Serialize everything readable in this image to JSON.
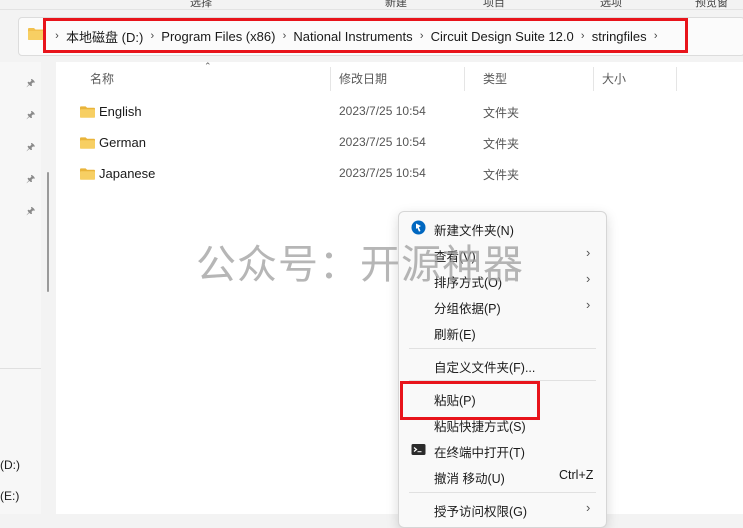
{
  "top_fragments": [
    "选择",
    "新建",
    "项目",
    "选项",
    "预览窗"
  ],
  "breadcrumb": {
    "items": [
      "本地磁盘 (D:)",
      "Program Files (x86)",
      "National Instruments",
      "Circuit Design Suite 12.0",
      "stringfiles"
    ]
  },
  "columns": {
    "name": "名称",
    "date": "修改日期",
    "type": "类型",
    "size": "大小"
  },
  "files": [
    {
      "name": "English",
      "date": "2023/7/25 10:54",
      "type": "文件夹"
    },
    {
      "name": "German",
      "date": "2023/7/25 10:54",
      "type": "文件夹"
    },
    {
      "name": "Japanese",
      "date": "2023/7/25 10:54",
      "type": "文件夹"
    }
  ],
  "nav": {
    "drive_d": "(D:)",
    "drive_e": "(E:)"
  },
  "context_menu": {
    "new_folder": "新建文件夹(N)",
    "view": "查看(V)",
    "sort": "排序方式(O)",
    "group": "分组依据(P)",
    "refresh": "刷新(E)",
    "customize": "自定义文件夹(F)...",
    "paste": "粘贴(P)",
    "paste_shortcut": "粘贴快捷方式(S)",
    "open_terminal": "在终端中打开(T)",
    "undo_move": "撤消 移动(U)",
    "undo_shortcut": "Ctrl+Z",
    "grant_access": "授予访问权限(G)"
  },
  "watermark": "公众号：开源神器",
  "colors": {
    "accent": "#0067c0",
    "highlight_red": "#e8141b",
    "folder": "#f2c14e"
  }
}
